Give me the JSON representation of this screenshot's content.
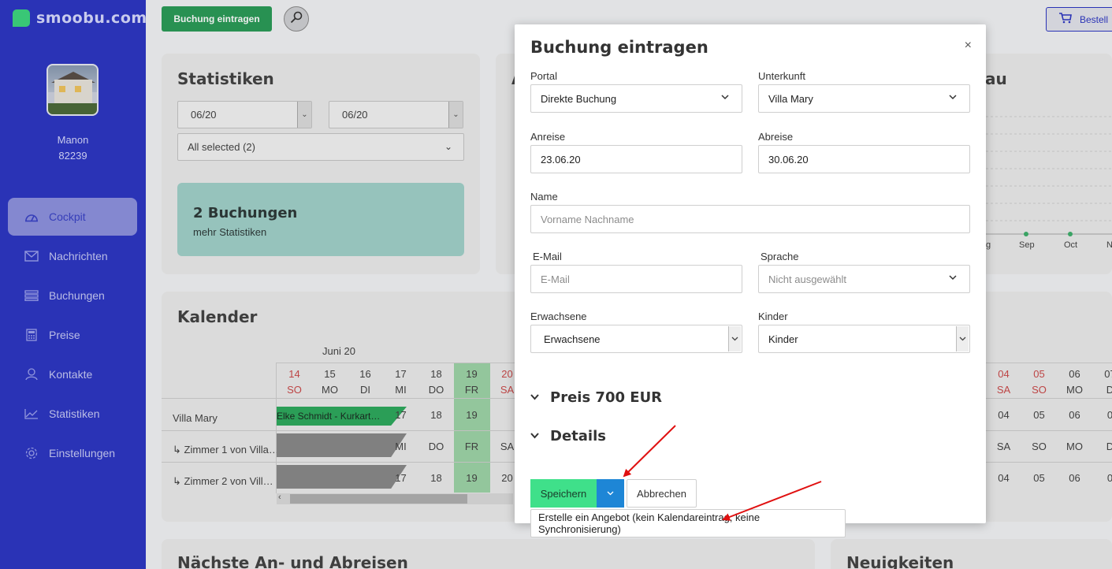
{
  "brand": {
    "name": "smoobu.com"
  },
  "user": {
    "name": "Manon",
    "id": "82239"
  },
  "sidebar": {
    "items": [
      {
        "label": "Cockpit",
        "icon": "speedometer-icon"
      },
      {
        "label": "Nachrichten",
        "icon": "envelope-icon"
      },
      {
        "label": "Buchungen",
        "icon": "list-icon"
      },
      {
        "label": "Preise",
        "icon": "calculator-icon"
      },
      {
        "label": "Kontakte",
        "icon": "person-icon"
      },
      {
        "label": "Statistiken",
        "icon": "chart-icon"
      },
      {
        "label": "Einstellungen",
        "icon": "gear-icon"
      }
    ]
  },
  "topbar": {
    "add_booking_label": "Buchung eintragen",
    "order_label": "Bestell"
  },
  "stats_card": {
    "title": "Statistiken",
    "from": "06/20",
    "to": "06/20",
    "filter": "All selected (2)",
    "count": "2 Buchungen",
    "link": "mehr Statistiken"
  },
  "right_card": {
    "title_fragment": "au",
    "months": [
      "g",
      "Sep",
      "Oct",
      "N"
    ]
  },
  "left_card_fragment": "A",
  "calendar": {
    "title": "Kalender",
    "month": "Juni 20",
    "days": [
      {
        "num": "14",
        "dow": "SO",
        "weekend": true
      },
      {
        "num": "15",
        "dow": "MO",
        "weekend": false
      },
      {
        "num": "16",
        "dow": "DI",
        "weekend": false
      },
      {
        "num": "17",
        "dow": "MI",
        "weekend": false
      },
      {
        "num": "18",
        "dow": "DO",
        "weekend": false
      },
      {
        "num": "19",
        "dow": "FR",
        "weekend": false
      },
      {
        "num": "20",
        "dow": "SA",
        "weekend": true
      }
    ],
    "right_days": [
      {
        "num": "04",
        "dow": "SA",
        "weekend": true
      },
      {
        "num": "05",
        "dow": "SO",
        "weekend": true
      },
      {
        "num": "06",
        "dow": "MO",
        "weekend": false
      },
      {
        "num": "07",
        "dow": "D",
        "weekend": false
      }
    ],
    "rows": [
      {
        "label": "Villa Mary",
        "cells": [
          "17",
          "18",
          "19"
        ],
        "right": [
          "04",
          "05",
          "06",
          "0"
        ]
      },
      {
        "label": "↳  Zimmer 1 von Villa…",
        "cells": [
          "MI",
          "DO",
          "FR",
          "SA"
        ],
        "right": [
          "SA",
          "SO",
          "MO",
          "D"
        ]
      },
      {
        "label": "↳  Zimmer 2 von Vill…",
        "cells": [
          "17",
          "18",
          "19",
          "20"
        ],
        "right": [
          "04",
          "05",
          "06",
          "0"
        ]
      }
    ],
    "booking_label": "Elke Schmidt - Kurkart…"
  },
  "bottom": {
    "left_title": "Nächste An- und Abreisen",
    "right_title": "Neuigkeiten"
  },
  "modal": {
    "title": "Buchung eintragen",
    "close": "×",
    "portal_label": "Portal",
    "portal_value": "Direkte Buchung",
    "unterkunft_label": "Unterkunft",
    "unterkunft_value": "Villa Mary",
    "anreise_label": "Anreise",
    "anreise_value": "23.06.20",
    "abreise_label": "Abreise",
    "abreise_value": "30.06.20",
    "name_label": "Name",
    "name_placeholder": "Vorname Nachname",
    "email_label": "E-Mail",
    "email_placeholder": "E-Mail",
    "sprache_label": "Sprache",
    "sprache_value": "Nicht ausgewählt",
    "erwachsene_label": "Erwachsene",
    "erwachsene_value": "Erwachsene",
    "kinder_label": "Kinder",
    "kinder_value": "Kinder",
    "preis_section": "Preis 700 EUR",
    "details_section": "Details",
    "save_label": "Speichern",
    "cancel_label": "Abbrechen",
    "dropdown_option": "Erstelle ein Angebot (kein Kalendareintrag, keine Synchronisierung)"
  },
  "colors": {
    "sidebar": "#2e37c4",
    "accent_green": "#3fe08a",
    "split_blue": "#1e86d6",
    "annotation_red": "#e01010"
  }
}
